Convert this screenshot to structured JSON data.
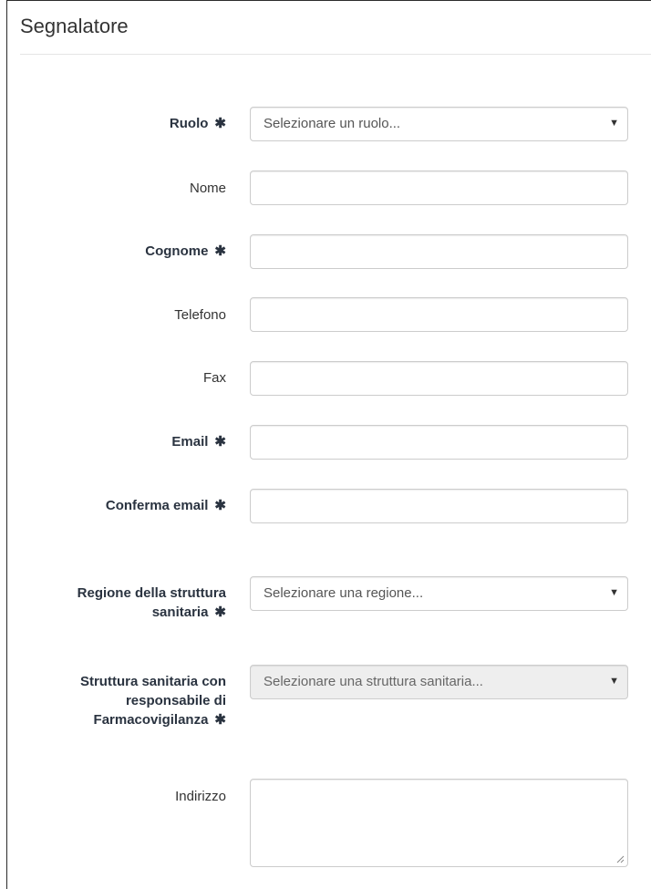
{
  "section": {
    "title": "Segnalatore"
  },
  "required_marker": "✱",
  "fields": {
    "ruolo": {
      "label": "Ruolo",
      "placeholder": "Selezionare un ruolo..."
    },
    "nome": {
      "label": "Nome",
      "value": ""
    },
    "cognome": {
      "label": "Cognome",
      "value": ""
    },
    "telefono": {
      "label": "Telefono",
      "value": ""
    },
    "fax": {
      "label": "Fax",
      "value": ""
    },
    "email": {
      "label": "Email",
      "value": ""
    },
    "conferma_email": {
      "label": "Conferma email",
      "value": ""
    },
    "regione": {
      "label_line1": "Regione della struttura",
      "label_line2": "sanitaria",
      "placeholder": "Selezionare una regione..."
    },
    "struttura": {
      "label_line1": "Struttura sanitaria con",
      "label_line2": "responsabile di",
      "label_line3": "Farmacovigilanza",
      "placeholder": "Selezionare una struttura sanitaria..."
    },
    "indirizzo": {
      "label": "Indirizzo",
      "value": ""
    }
  },
  "icons": {
    "caret": "▼"
  }
}
